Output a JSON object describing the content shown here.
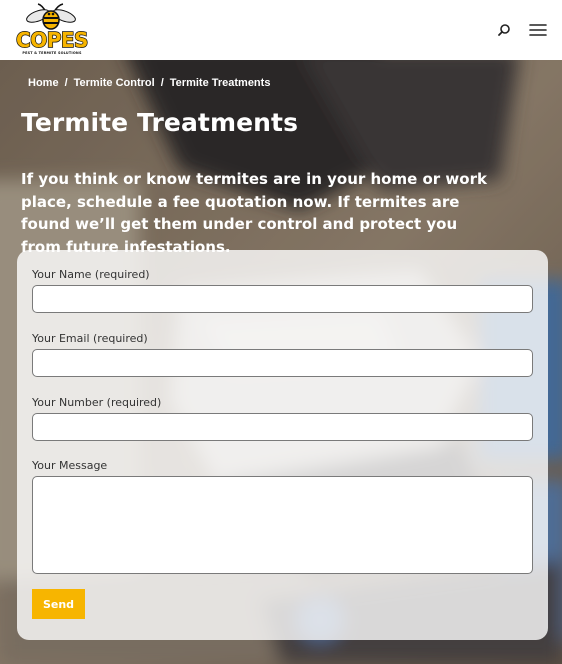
{
  "brand": {
    "name": "COPES",
    "tagline": "PEST & TERMITE SOLUTIONS",
    "colors": {
      "gold": "#f7b500",
      "black": "#111111"
    }
  },
  "header": {
    "icons": [
      "search-icon",
      "hamburger-menu-icon"
    ]
  },
  "breadcrumb": {
    "items": [
      "Home",
      "Termite Control",
      "Termite Treatments"
    ],
    "separator": "/"
  },
  "page": {
    "title": "Termite Treatments",
    "lead": "If you think or know termites are in your home or work place, schedule a fee quotation now. If termites are found we’ll get them under control and protect you from future infestations."
  },
  "form": {
    "fields": [
      {
        "label": "Your Name (required)",
        "value": ""
      },
      {
        "label": "Your Email (required)",
        "value": ""
      },
      {
        "label": "Your Number (required)",
        "value": ""
      },
      {
        "label": "Your Message",
        "value": ""
      }
    ],
    "submit_label": "Send"
  }
}
